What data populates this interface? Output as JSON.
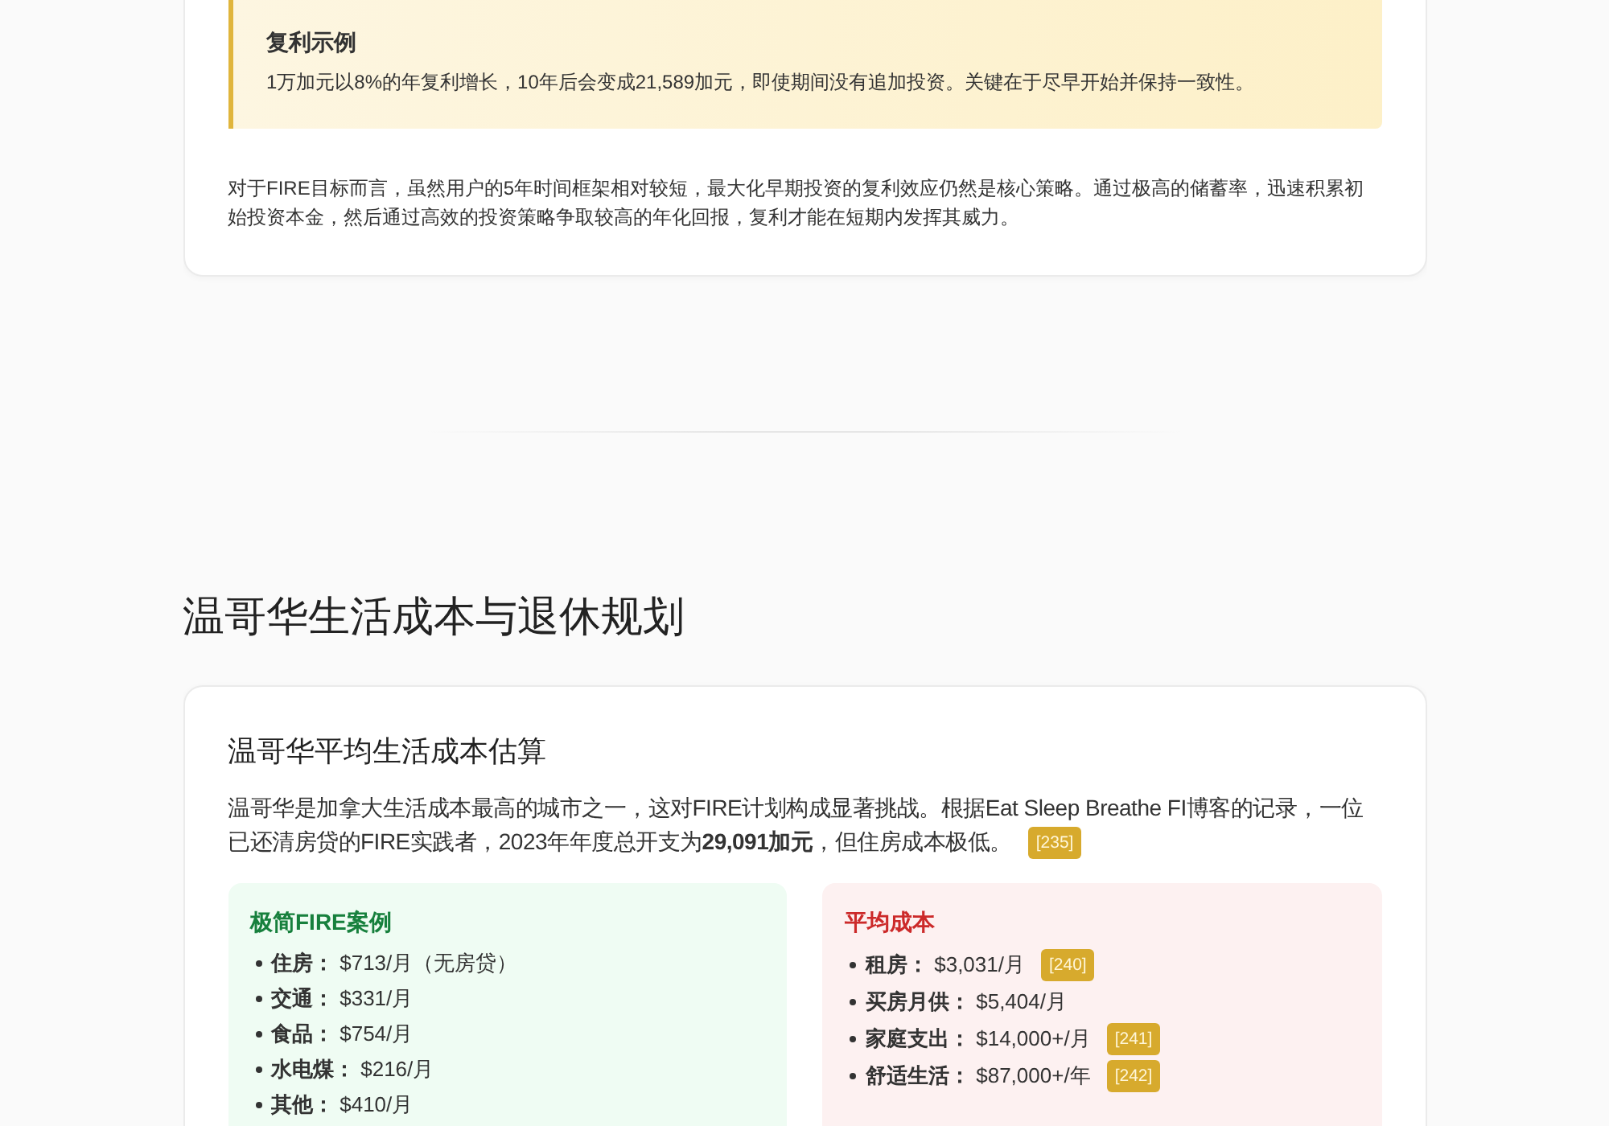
{
  "intro_section": {
    "callout": {
      "title": "复利示例",
      "text": "1万加元以8%的年复利增长，10年后会变成21,589加元，即使期间没有追加投资。关键在于尽早开始并保持一致性。"
    },
    "paragraph": "对于FIRE目标而言，虽然用户的5年时间框架相对较短，最大化早期投资的复利效应仍然是核心策略。通过极高的储蓄率，迅速积累初始投资本金，然后通过高效的投资策略争取较高的年化回报，复利才能在短期内发挥其威力。"
  },
  "vancouver_section": {
    "heading": "温哥华生活成本与退休规划",
    "card": {
      "title": "温哥华平均生活成本估算",
      "paragraph": "温哥华是加拿大生活成本最高的城市之一，这对FIRE计划构成显著挑战。根据Eat Sleep Breathe FI博客的记录，一位已还清房贷的FIRE实践者，2023年年度总开支为**29,091加元**，但住房成本极低。",
      "citation": "[235]",
      "panels": [
        {
          "kind": "positive",
          "title": "极简FIRE案例",
          "items": [
            {
              "text": "**住房：** $713/月（无房贷）"
            },
            {
              "text": "**交通：** $331/月"
            },
            {
              "text": "**食品：** $754/月"
            },
            {
              "text": "**水电煤：** $216/月"
            },
            {
              "text": "**其他：** $410/月"
            }
          ]
        },
        {
          "kind": "negative",
          "title": "平均成本",
          "items": [
            {
              "text": "**租房：** $3,031/月",
              "citation": "[240]"
            },
            {
              "text": "**买房月供：** $5,404/月"
            },
            {
              "text": "**家庭支出：** $14,000+/月",
              "citation": "[241]"
            },
            {
              "text": "**舒适生活：** $87,000+/年",
              "citation": "[242]"
            }
          ]
        }
      ]
    }
  }
}
